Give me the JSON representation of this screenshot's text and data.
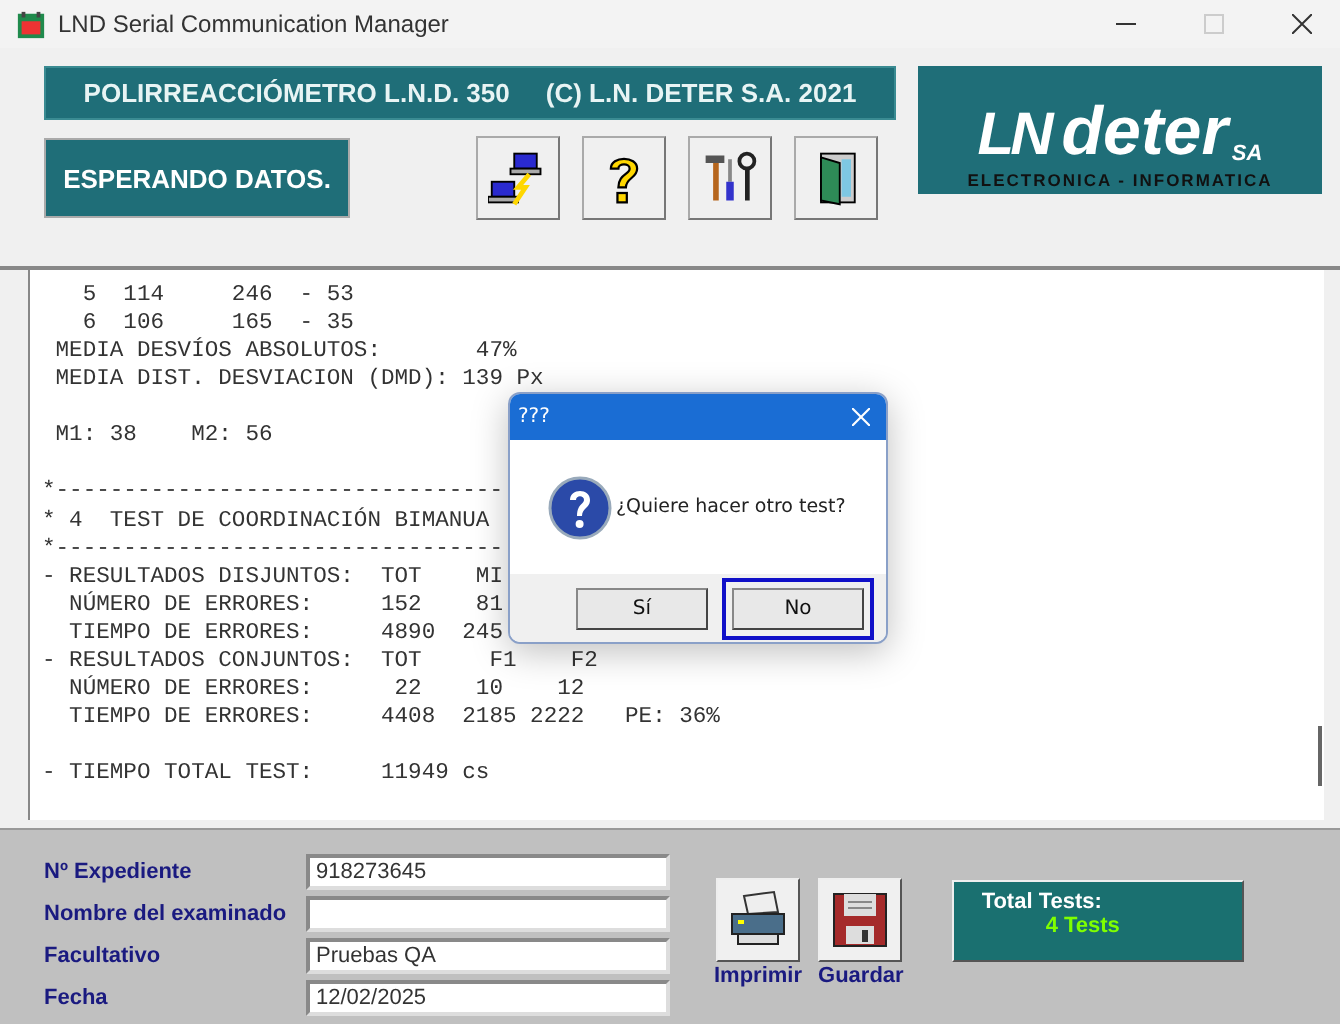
{
  "window": {
    "title": "LND Serial Communication Manager",
    "maximize_disabled": true
  },
  "banner": {
    "product": "POLIRREACCIÓMETRO L.N.D. 350",
    "copyright": "(C) L.N. DETER S.A. 2021"
  },
  "status": "ESPERANDO DATOS.",
  "toolbar": [
    {
      "kind": "transfer"
    },
    {
      "kind": "help"
    },
    {
      "kind": "tools"
    },
    {
      "kind": "exit"
    }
  ],
  "logo": {
    "brand": "LN",
    "name": "deter",
    "suffix": "SA",
    "tagline": "ELECTRONICA - INFORMATICA"
  },
  "report": [
    [
      "   5  114     246  - 53",
      "   6  106     165  - 35",
      " MEDIA DESVÍOS ABSOLUTOS:       47%",
      " MEDIA DIST. DESVIACION (DMD): 139 Px"
    ],
    [
      " M1: 38    M2: 56"
    ],
    [
      "*---------------------------------",
      "* 4  TEST DE COORDINACIÓN BIMANUA",
      "*---------------------------------",
      "- RESULTADOS DISJUNTOS:  TOT    MI",
      "  NÚMERO DE ERRORES:     152    81",
      "  TIEMPO DE ERRORES:     4890  245",
      "- RESULTADOS CONJUNTOS:  TOT     F1    F2",
      "  NÚMERO DE ERRORES:      22    10    12",
      "  TIEMPO DE ERRORES:     4408  2185 2222   PE: 36%"
    ],
    [
      "- TIEMPO TOTAL TEST:     11949 cs"
    ]
  ],
  "dialog": {
    "title": "???",
    "message": "¿Quiere hacer otro test?",
    "buttons": [
      {
        "label": "Sí",
        "selected": false
      },
      {
        "label": "No",
        "selected": true
      }
    ]
  },
  "form": [
    {
      "label": "Nº Expediente",
      "value": "918273645"
    },
    {
      "label": "Nombre del examinado"
    },
    {
      "label": "Facultativo",
      "value": "Pruebas QA"
    },
    {
      "label": "Fecha",
      "value": "12/02/2025"
    }
  ],
  "actions": [
    {
      "kind": "print",
      "label": "Imprimir"
    },
    {
      "kind": "save",
      "label": "Guardar"
    }
  ],
  "total": {
    "label": "Total Tests:",
    "value": "4 Tests"
  }
}
